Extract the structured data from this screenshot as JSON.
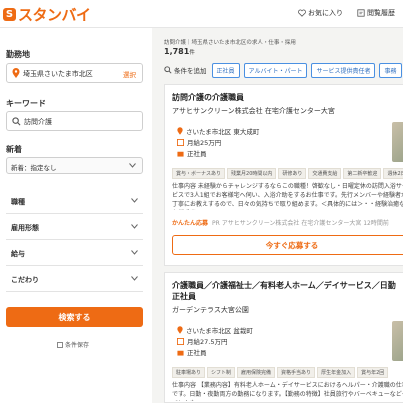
{
  "header": {
    "logo_mark": "б",
    "logo_text": "スタンバイ",
    "favorites_label": "お気に入り",
    "history_label": "閲覧履歴"
  },
  "sidebar": {
    "location_label": "勤務地",
    "location_value": "埼玉県さいたま市北区",
    "location_select": "選択",
    "keyword_label": "キーワード",
    "keyword_value": "訪問介護",
    "new_label": "新着",
    "new_value": "新着：指定なし",
    "filters": [
      "職種",
      "雇用形態",
      "給与",
      "こだわり"
    ],
    "search_button": "検索する",
    "save_label": "条件保存"
  },
  "main": {
    "breadcrumb": "訪問介護｜埼玉県さいたま市北区の求人・仕事・採用",
    "count": "1,781",
    "count_unit": "件",
    "cond_label": "条件を追加",
    "chips": [
      "正社員",
      "アルバイト・パート",
      "サービス提供責任者",
      "事務"
    ]
  },
  "jobs": [
    {
      "title": "訪問介護の介護職員",
      "company": "アサヒサンクリーン株式会社 在宅介護センター大宮",
      "location": "さいたま市北区 東大成町",
      "salary": "月給25万円",
      "type": "正社員",
      "tags": [
        "賞与・ボーナスあり",
        "残業月20時間以内",
        "研修あり",
        "交通費支給",
        "第二新卒歓迎",
        "週休2日"
      ],
      "desc": "仕事内容 未経験からチャレンジするならこの職種！啓歓なし・日曜定休の訪問入浴サービスで3人1組でお客様宅へ伺い、入浴介助をするお仕事です。先行メンバーや経験者が丁寧にお教えするので、日々の気持ちで取り組めます。＜具体的には＞・・経験治癒など各種手当",
      "easy_label": "かんたん応募",
      "easy_company": "PR アサヒサンクリーン株式会社 在宅介護センター大宮 12時間前",
      "apply": "今すぐ応募する"
    },
    {
      "title": "介護職員／介護福祉士／有料老人ホーム／デイサービス／日勤",
      "title2": "正社員",
      "company": "ガーデンテラス大宮公園",
      "location": "さいたま市北区 盆栽町",
      "salary": "月給27.5万円",
      "type": "正社員",
      "tags": [
        "駐車場あり",
        "シフト制",
        "雇用保険完備",
        "資格手当あり",
        "厚生年金加入",
        "賞与年2回"
      ],
      "desc": "仕事内容 【業務内容】有料老人ホーム・デイサービスにおけるヘルパー・介護職の仕事です。日勤・夜勤両方の勤務になります。【勤務の特徴】社員旅行やバーベキューなどイベントも"
    }
  ]
}
